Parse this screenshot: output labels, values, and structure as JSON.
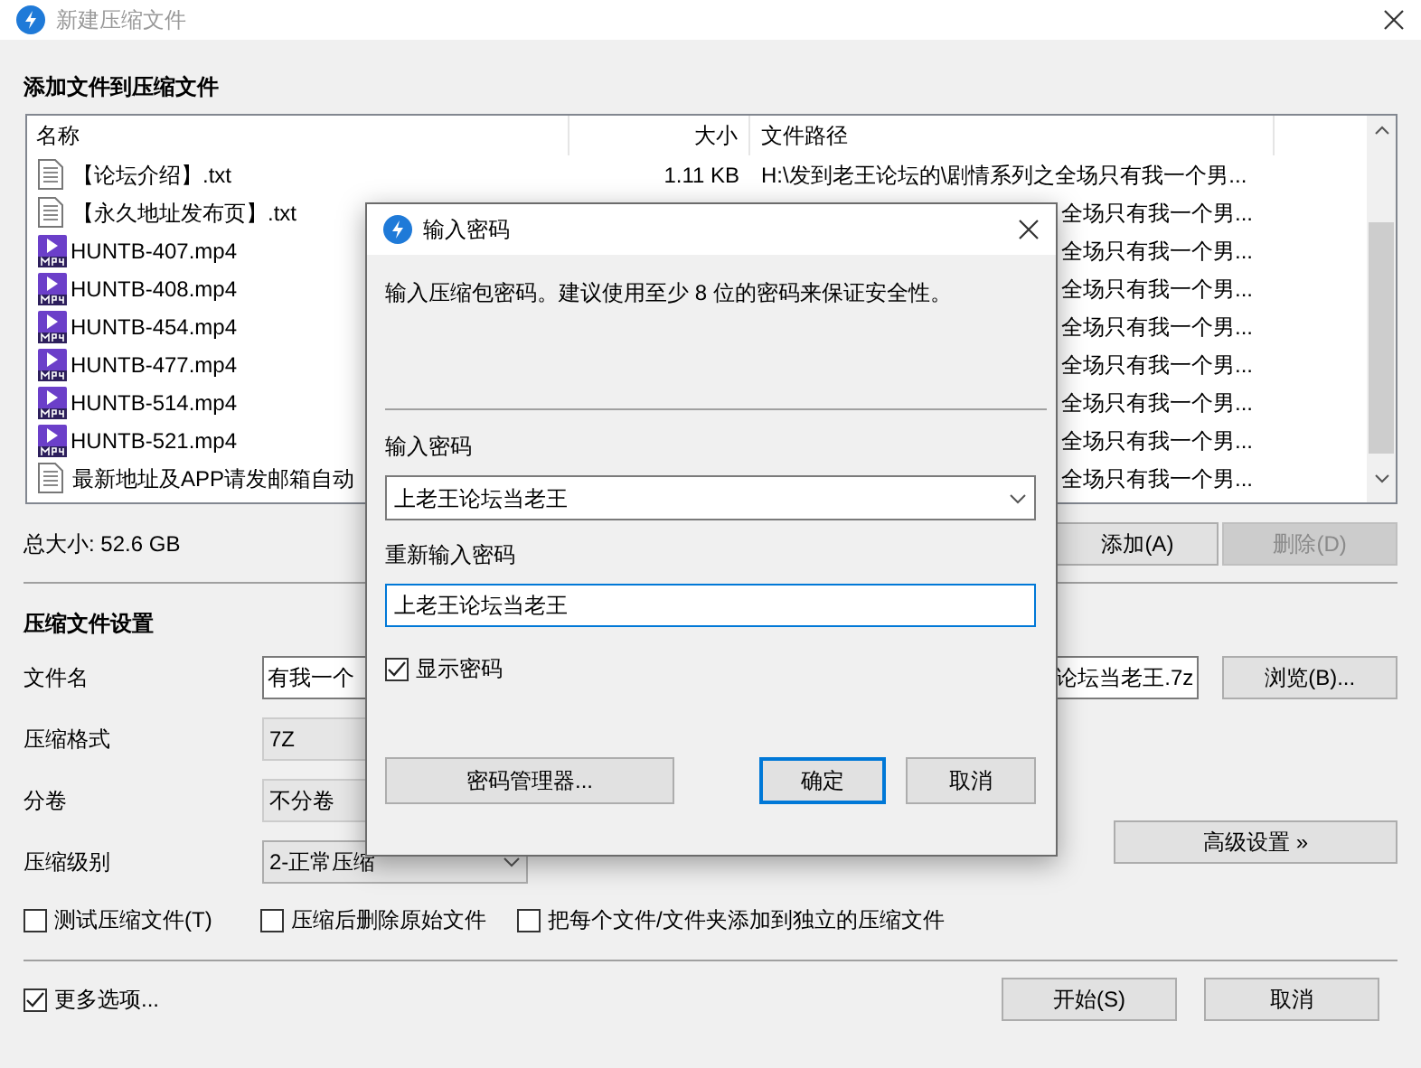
{
  "window": {
    "title": "新建压缩文件",
    "active": false
  },
  "files": {
    "heading": "添加文件到压缩文件",
    "columns": [
      "名称",
      "大小",
      "文件路径"
    ],
    "rows": [
      {
        "kind": "txt",
        "name": "【论坛介绍】.txt",
        "size": "1.11 KB",
        "path": "H:\\发到老王论坛的\\剧情系列之全场只有我一个男..."
      },
      {
        "kind": "txt",
        "name": "【永久地址发布页】.txt",
        "path": "全场只有我一个男..."
      },
      {
        "kind": "video",
        "name": "HUNTB-407.mp4",
        "path": "全场只有我一个男..."
      },
      {
        "kind": "video",
        "name": "HUNTB-408.mp4",
        "path": "全场只有我一个男..."
      },
      {
        "kind": "video",
        "name": "HUNTB-454.mp4",
        "path": "全场只有我一个男..."
      },
      {
        "kind": "video",
        "name": "HUNTB-477.mp4",
        "path": "全场只有我一个男..."
      },
      {
        "kind": "video",
        "name": "HUNTB-514.mp4",
        "path": "全场只有我一个男..."
      },
      {
        "kind": "video",
        "name": "HUNTB-521.mp4",
        "path": "全场只有我一个男..."
      },
      {
        "kind": "txt",
        "name": "最新地址及APP请发邮箱自动",
        "path": "全场只有我一个男..."
      }
    ],
    "total_size": "总大小: 52.6 GB",
    "buttons": [
      {
        "label": "添加(A)",
        "disabled": false
      },
      {
        "label": "删除(D)",
        "disabled": true
      }
    ]
  },
  "settings": {
    "heading": "压缩文件设置",
    "filename": {
      "label": "文件名",
      "value_start": "有我一个",
      "value_end": "论坛当老王.7z",
      "button": "浏览(B)..."
    },
    "combos": [
      {
        "label": "压缩格式",
        "value": "7Z",
        "disabled": true
      },
      {
        "label": "分卷",
        "value": "不分卷",
        "disabled": true
      },
      {
        "label": "压缩级别",
        "value": "2-正常压缩",
        "disabled": false
      }
    ],
    "advanced_button": "高级设置 »",
    "checkboxes": [
      {
        "label": "测试压缩文件(T)",
        "checked": false
      },
      {
        "label": "压缩后删除原始文件",
        "checked": false
      },
      {
        "label": "把每个文件/文件夹添加到独立的压缩文件",
        "checked": false
      }
    ]
  },
  "footer": {
    "more_options": {
      "label": "更多选项...",
      "checked": true
    },
    "buttons": [
      "开始(S)",
      "取消"
    ]
  },
  "dialog": {
    "title": "输入密码",
    "description": "输入压缩包密码。建议使用至少 8 位的密码来保证安全性。",
    "password_label": "输入密码",
    "password": "上老王论坛当老王",
    "repeat_label": "重新输入密码",
    "repeat": "上老王论坛当老王",
    "show_password": {
      "label": "显示密码",
      "checked": true
    },
    "buttons": [
      {
        "label": "密码管理器...",
        "default": false
      },
      {
        "label": "确定",
        "default": true
      },
      {
        "label": "取消",
        "default": false
      }
    ]
  }
}
